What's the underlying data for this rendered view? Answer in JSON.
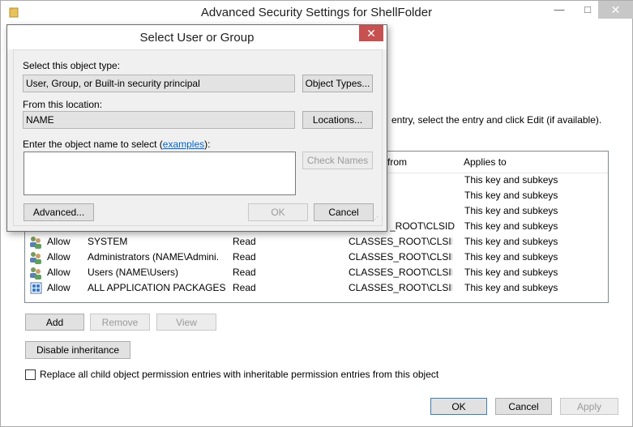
{
  "main_window": {
    "title": "Advanced Security Settings for ShellFolder",
    "controls": {
      "minimize": "—",
      "maximize": "□",
      "close": "✕"
    },
    "info_text": "entry, select the entry and click Edit (if available).",
    "columns": {
      "inherited_from": "from",
      "applies_to": "Applies to"
    },
    "partial_rows": [
      {
        "applies_to": "This key and subkeys"
      },
      {
        "applies_to": "This key and subkeys"
      },
      {
        "applies_to": "This key and subkeys"
      },
      {
        "inherited_from": "_ROOT\\CLSID...",
        "applies_to": "This key and subkeys"
      }
    ],
    "rows": [
      {
        "icon": "user-group-icon",
        "type": "Allow",
        "principal": "SYSTEM",
        "access": "Read",
        "inherited_from": "CLASSES_ROOT\\CLSID...",
        "applies_to": "This key and subkeys"
      },
      {
        "icon": "user-group-icon",
        "type": "Allow",
        "principal": "Administrators (NAME\\Admini...",
        "access": "Read",
        "inherited_from": "CLASSES_ROOT\\CLSID...",
        "applies_to": "This key and subkeys"
      },
      {
        "icon": "user-group-icon",
        "type": "Allow",
        "principal": "Users (NAME\\Users)",
        "access": "Read",
        "inherited_from": "CLASSES_ROOT\\CLSID...",
        "applies_to": "This key and subkeys"
      },
      {
        "icon": "app-package-icon",
        "type": "Allow",
        "principal": "ALL APPLICATION PACKAGES",
        "access": "Read",
        "inherited_from": "CLASSES_ROOT\\CLSID...",
        "applies_to": "This key and subkeys"
      }
    ],
    "buttons": {
      "add": "Add",
      "remove": "Remove",
      "view": "View",
      "disable_inheritance": "Disable inheritance",
      "ok": "OK",
      "cancel": "Cancel",
      "apply": "Apply"
    },
    "replace_checkbox": {
      "label": "Replace all child object permission entries with inheritable permission entries from this object",
      "checked": false
    }
  },
  "dialog": {
    "title": "Select User or Group",
    "close": "✕",
    "object_type_label": "Select this object type:",
    "object_type_value": "User, Group, or Built-in security principal",
    "object_types_button": "Object Types...",
    "location_label": "From this location:",
    "location_value": "NAME",
    "locations_button": "Locations...",
    "name_label_prefix": "Enter the object name to select (",
    "name_label_link": "examples",
    "name_label_suffix": "):",
    "name_value": "",
    "check_names_button": "Check Names",
    "advanced_button": "Advanced...",
    "ok_button": "OK",
    "cancel_button": "Cancel"
  },
  "colors": {
    "window_bg": "#f0f0f0",
    "close_red": "#c75050",
    "link": "#0066cc"
  }
}
